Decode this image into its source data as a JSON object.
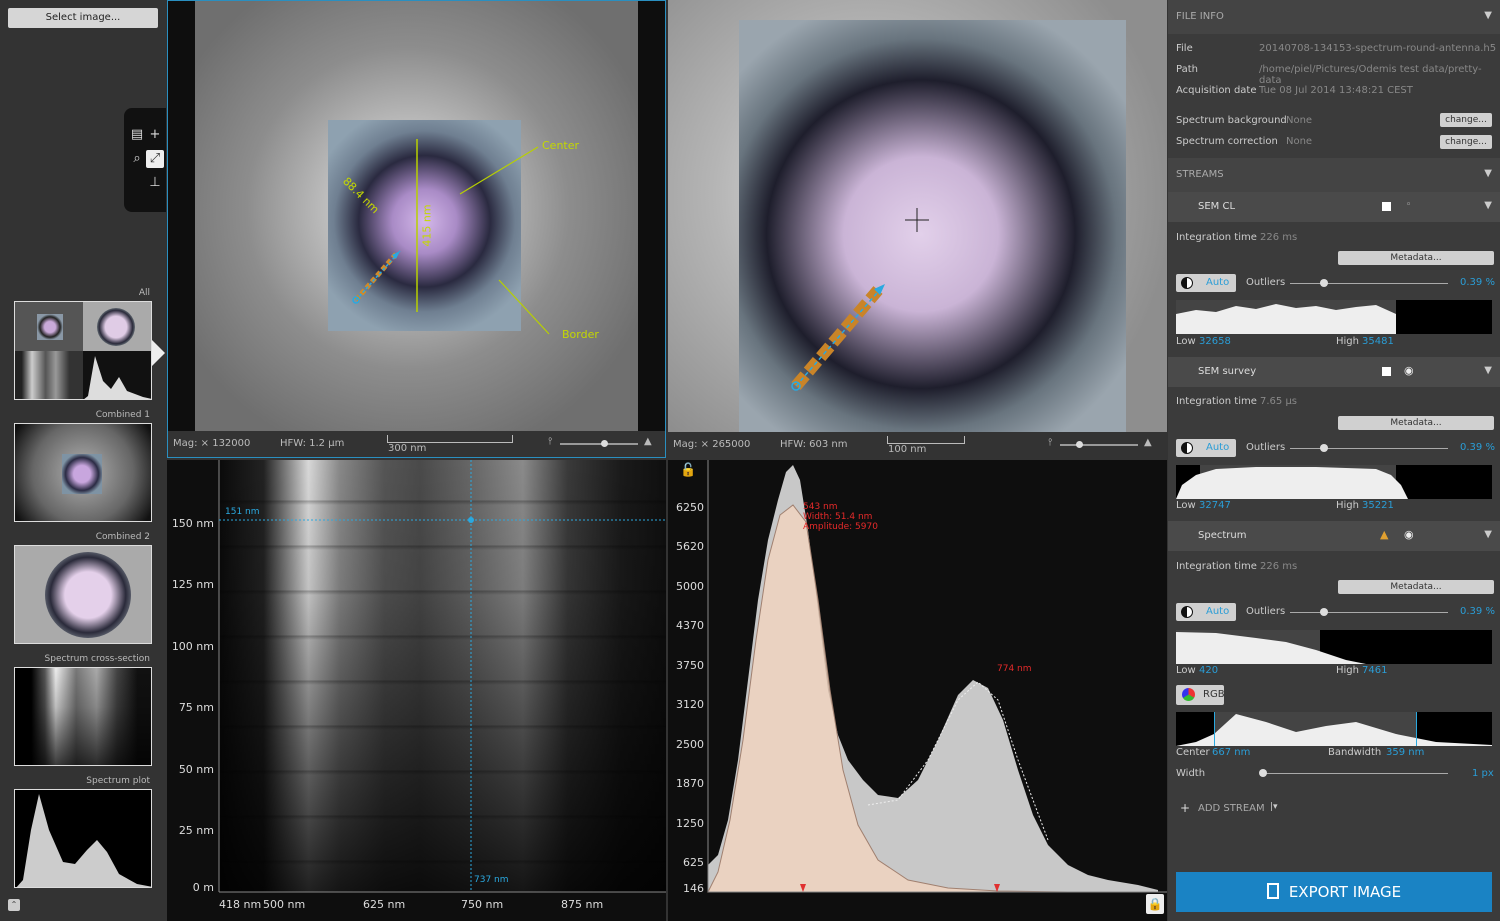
{
  "left": {
    "select_label": "Select image...",
    "thumbs": [
      "All",
      "Combined 1",
      "Combined 2",
      "Spectrum cross-section",
      "Spectrum plot"
    ]
  },
  "view1": {
    "mag": "Mag: × 132000",
    "hfw": "HFW: 1.2 µm",
    "scale": "300 nm",
    "ann_center": "Center",
    "ann_border": "Border",
    "ann_diam": "88.4 nm",
    "ann_vert": "415 nm"
  },
  "view2": {
    "mag": "Mag: × 265000",
    "hfw": "HFW: 603 nm",
    "scale": "100 nm"
  },
  "view3": {
    "y_ticks": [
      "150 nm",
      "125 nm",
      "100 nm",
      "75 nm",
      "50 nm",
      "25 nm",
      "0 m"
    ],
    "x_ticks": [
      "418 nm",
      "500 nm",
      "625 nm",
      "750 nm",
      "875 nm"
    ],
    "cursor_y": "151 nm",
    "cursor_x": "737 nm"
  },
  "view4": {
    "y_ticks": [
      "6250",
      "5620",
      "5000",
      "4370",
      "3750",
      "3120",
      "2500",
      "1870",
      "1250",
      "625",
      "146"
    ],
    "peak1_line1": "543 nm",
    "peak1_line2": "Width: 51.4 nm",
    "peak1_line3": "Amplitude: 5970",
    "peak2": "774 nm"
  },
  "right": {
    "file_info_head": "FILE INFO",
    "file_label": "File",
    "file_value": "20140708-134153-spectrum-round-antenna.h5",
    "path_label": "Path",
    "path_value": "/home/piel/Pictures/Odemis test data/pretty-data",
    "acq_label": "Acquisition date",
    "acq_value": "Tue 08 Jul 2014 13:48:21 CEST",
    "bg_label": "Spectrum background",
    "bg_value": "None",
    "corr_label": "Spectrum correction",
    "corr_value": "None",
    "change": "change...",
    "streams_head": "STREAMS",
    "streams": [
      {
        "name": "SEM CL",
        "int_label": "Integration time",
        "int_value": "226 ms",
        "meta": "Metadata...",
        "auto": "Auto",
        "outliers": "Outliers",
        "pct": "0.39 %",
        "low_label": "Low",
        "low": "32658",
        "high_label": "High",
        "high": "35481"
      },
      {
        "name": "SEM survey",
        "int_label": "Integration time",
        "int_value": "7.65 µs",
        "meta": "Metadata...",
        "auto": "Auto",
        "outliers": "Outliers",
        "pct": "0.39 %",
        "low_label": "Low",
        "low": "32747",
        "high_label": "High",
        "high": "35221"
      },
      {
        "name": "Spectrum",
        "int_label": "Integration time",
        "int_value": "226 ms",
        "meta": "Metadata...",
        "auto": "Auto",
        "outliers": "Outliers",
        "pct": "0.39 %",
        "low_label": "Low",
        "low": "420",
        "high_label": "High",
        "high": "7461"
      }
    ],
    "rgb": "RGB",
    "center_label": "Center",
    "center_value": "667 nm",
    "bw_label": "Bandwidth",
    "bw_value": "359 nm",
    "width_label": "Width",
    "width_value": "1 px",
    "add_stream": "ADD STREAM",
    "export": "EXPORT IMAGE"
  }
}
